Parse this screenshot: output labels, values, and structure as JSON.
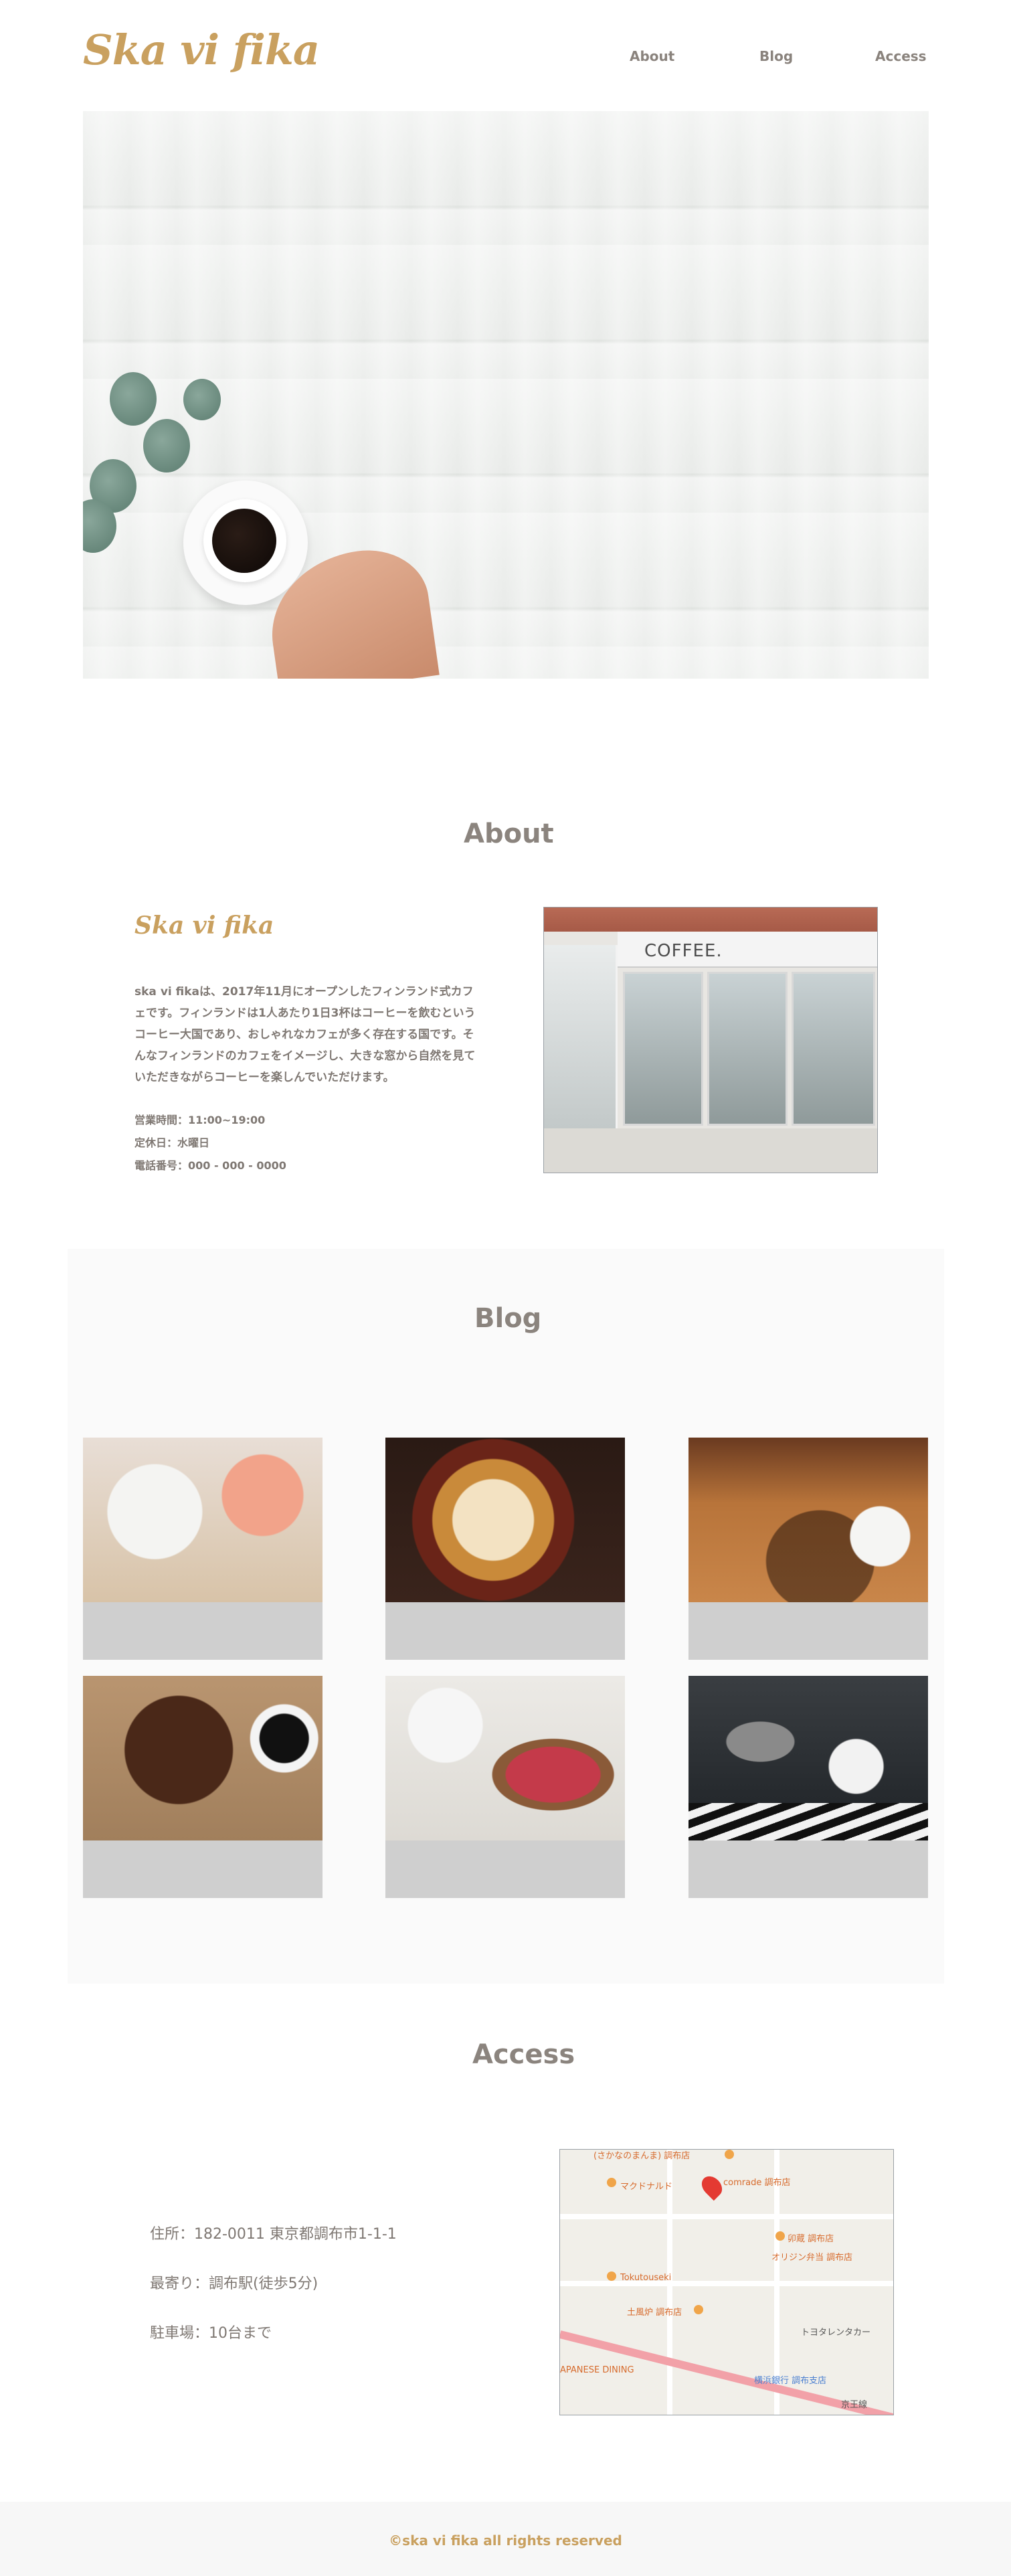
{
  "header": {
    "logo": "Ska vi fika",
    "nav": [
      "About",
      "Blog",
      "Access"
    ]
  },
  "about": {
    "title": "About",
    "name": "Ska vi fika",
    "description": "ska vi fikaは、2017年11月にオープンしたフィンランド式カフェです。フィンランドは1人あたり1日3杯はコーヒーを飲むというコーヒー大国であり、おしゃれなカフェが多く存在する国です。そんなフィンランドのカフェをイメージし、大きな窓から自然を見ていただきながらコーヒーを楽しんでいただけます。",
    "hours": "営業時間：11:00~19:00",
    "holiday": "定休日：水曜日",
    "phone": "電話番号：000 - 000 - 0000",
    "photo_sign": "COFFEE."
  },
  "blog": {
    "title": "Blog",
    "cards": [
      "cup-and-roses",
      "latte-art",
      "coffee-on-table",
      "bean-heart",
      "coffee-and-tart",
      "moka-pot"
    ]
  },
  "access": {
    "title": "Access",
    "address": "住所：182-0011 東京都調布市1-1-1",
    "station": "最寄り：調布駅(徒歩5分)",
    "parking": "駐車場：10台まで",
    "map_labels": {
      "l1": "(さかなのまんま) 調布店",
      "l2": "comrade 調布店",
      "l3": "マクドナルド",
      "l4": "卯蔵 調布店",
      "l5": "オリジン弁当 調布店",
      "l6": "Tokutouseki",
      "l7": "土風炉 調布店",
      "l8": "トヨタレンタカー",
      "l9": "APANESE DINING",
      "l10": "横浜銀行 調布支店",
      "l11": "京王線"
    }
  },
  "footer": {
    "copyright": "©ska vi fika all rights reserved"
  },
  "colors": {
    "accent": "#c9a05f",
    "heading": "#8b847e",
    "text": "#7f7873",
    "card_base": "#cfcfcf",
    "blog_bg": "#fafafa"
  }
}
